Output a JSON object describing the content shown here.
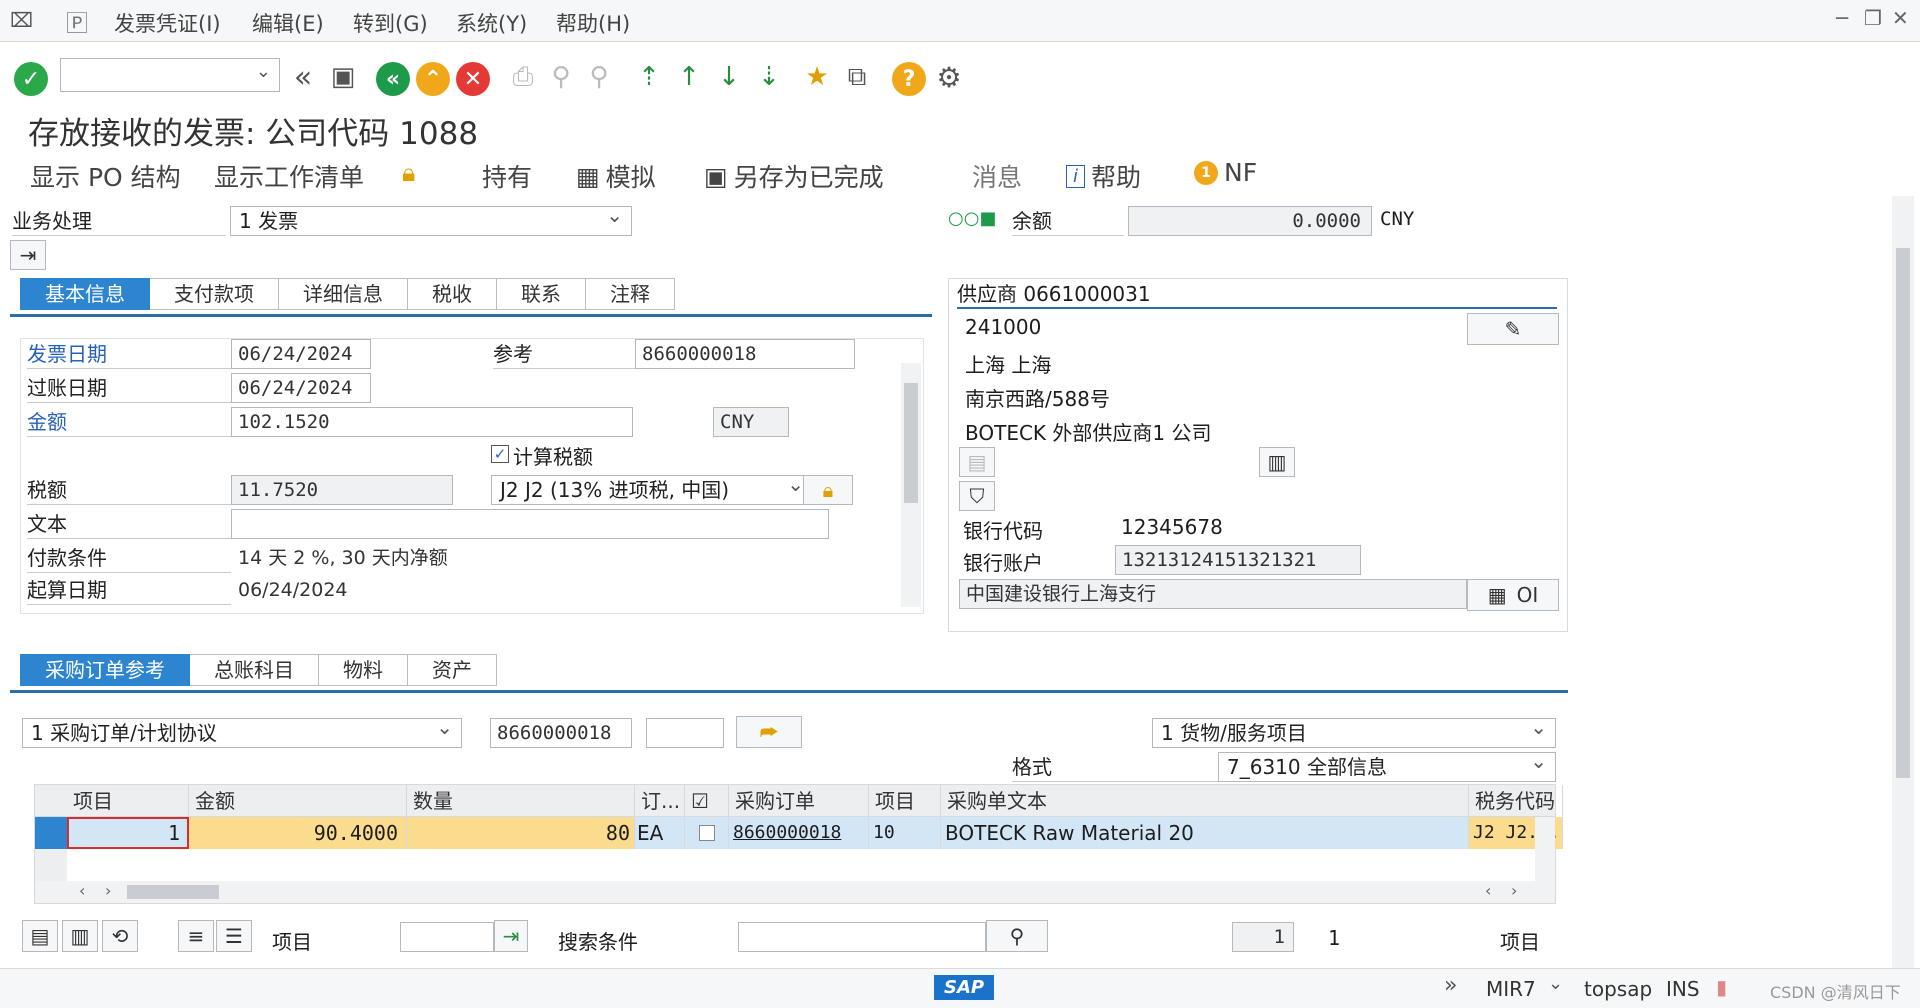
{
  "menu": {
    "items": [
      "发票凭证(I)",
      "编辑(E)",
      "转到(G)",
      "系统(Y)",
      "帮助(H)"
    ]
  },
  "window_controls": [
    "─",
    "❐",
    "✕"
  ],
  "title": "存放接收的发票: 公司代码 1088",
  "app_toolbar": {
    "display_po": "显示 PO 结构",
    "display_worklist": "显示工作清单",
    "hold": "持有",
    "simulate": "模拟",
    "save_completed": "另存为已完成",
    "messages": "消息",
    "help": "帮助",
    "nf": "NF"
  },
  "transaction": {
    "label": "业务处理",
    "value": "1 发票"
  },
  "balance": {
    "label": "余额",
    "value": "0.0000",
    "currency": "CNY"
  },
  "tabs_top": [
    "基本信息",
    "支付款项",
    "详细信息",
    "税收",
    "联系",
    "注释"
  ],
  "basic": {
    "invoice_date_label": "发票日期",
    "invoice_date": "06/24/2024",
    "reference_label": "参考",
    "reference": "8660000018",
    "posting_date_label": "过账日期",
    "posting_date": "06/24/2024",
    "amount_label": "金额",
    "amount": "102.1520",
    "currency": "CNY",
    "calc_tax_label": "计算税额",
    "tax_label": "税额",
    "tax_amount": "11.7520",
    "tax_code": "J2 J2 (13% 进项税, 中国)",
    "text_label": "文本",
    "text": "",
    "payment_terms_label": "付款条件",
    "payment_terms": "14 天 2 %, 30 天内净额",
    "baseline_label": "起算日期",
    "baseline_date": "06/24/2024"
  },
  "vendor": {
    "header": "供应商 0661000031",
    "postal": "241000",
    "city": "上海  上海",
    "street": "南京西路/588号",
    "name": "BOTECK 外部供应商1 公司",
    "bank_code_label": "银行代码",
    "bank_code": "12345678",
    "bank_account_label": "银行账户",
    "bank_account": "13213124151321321",
    "bank_name": "中国建设银行上海支行",
    "oi_label": "OI"
  },
  "tabs_bottom": [
    "采购订单参考",
    "总账科目",
    "物料",
    "资产"
  ],
  "po_ref": {
    "doc_type": "1 采购订单/计划协议",
    "po_number": "8660000018",
    "item_type": "1 货物/服务项目",
    "layout_label": "格式",
    "layout": "7_6310 全部信息"
  },
  "grid": {
    "headers": [
      "项目",
      "金额",
      "数量",
      "订...",
      "",
      "采购订单",
      "项目",
      "采购单文本",
      "税务代码"
    ],
    "rows": [
      {
        "item": "1",
        "amount": "90.4000",
        "qty": "80",
        "unit": "EA",
        "po": "8660000018",
        "po_item": "10",
        "text": "BOTECK Raw Material 20",
        "tax": "J2  J2..."
      }
    ]
  },
  "footer": {
    "item_label": "项目",
    "search_label": "搜索条件",
    "page": "1",
    "total": "1",
    "items_label": "项目"
  },
  "status": {
    "brand": "SAP",
    "tcode": "MIR7",
    "system": "topsap",
    "mode": "INS",
    "watermark": "CSDN @清风日下"
  }
}
